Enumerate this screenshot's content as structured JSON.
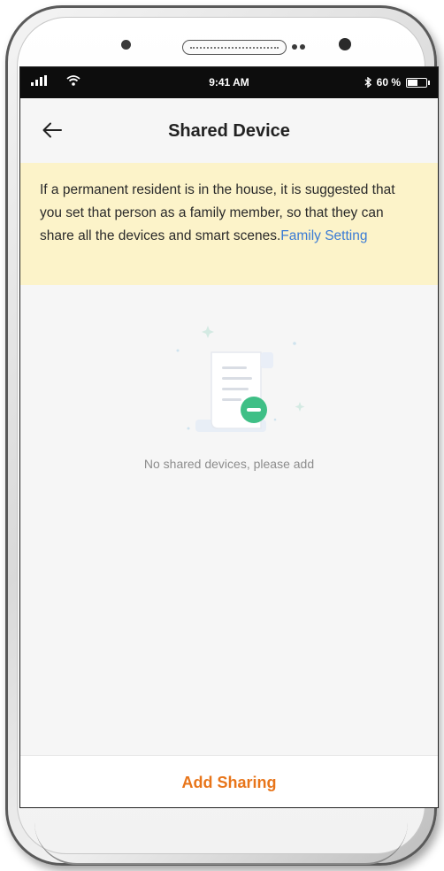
{
  "status_bar": {
    "time": "9:41 AM",
    "battery_text": "60 %",
    "battery_level": 0.6,
    "bluetooth_icon": "bluetooth-icon",
    "signal_icon": "signal-icon",
    "wifi_icon": "wifi-icon"
  },
  "header": {
    "title": "Shared Device",
    "back_icon": "arrow-left-icon"
  },
  "notice": {
    "text": "If a permanent resident is in the house, it is suggested that you set that person as a family member, so that they can share all the devices and smart scenes.",
    "link_label": "Family Setting",
    "background_color": "#fcf3c9",
    "link_color": "#3a7bd5"
  },
  "empty_state": {
    "icon": "document-remove-icon",
    "message": "No shared devices, please add",
    "accent_color": "#3fbf86"
  },
  "footer": {
    "add_sharing_label": "Add Sharing",
    "accent_color": "#e8751a"
  }
}
